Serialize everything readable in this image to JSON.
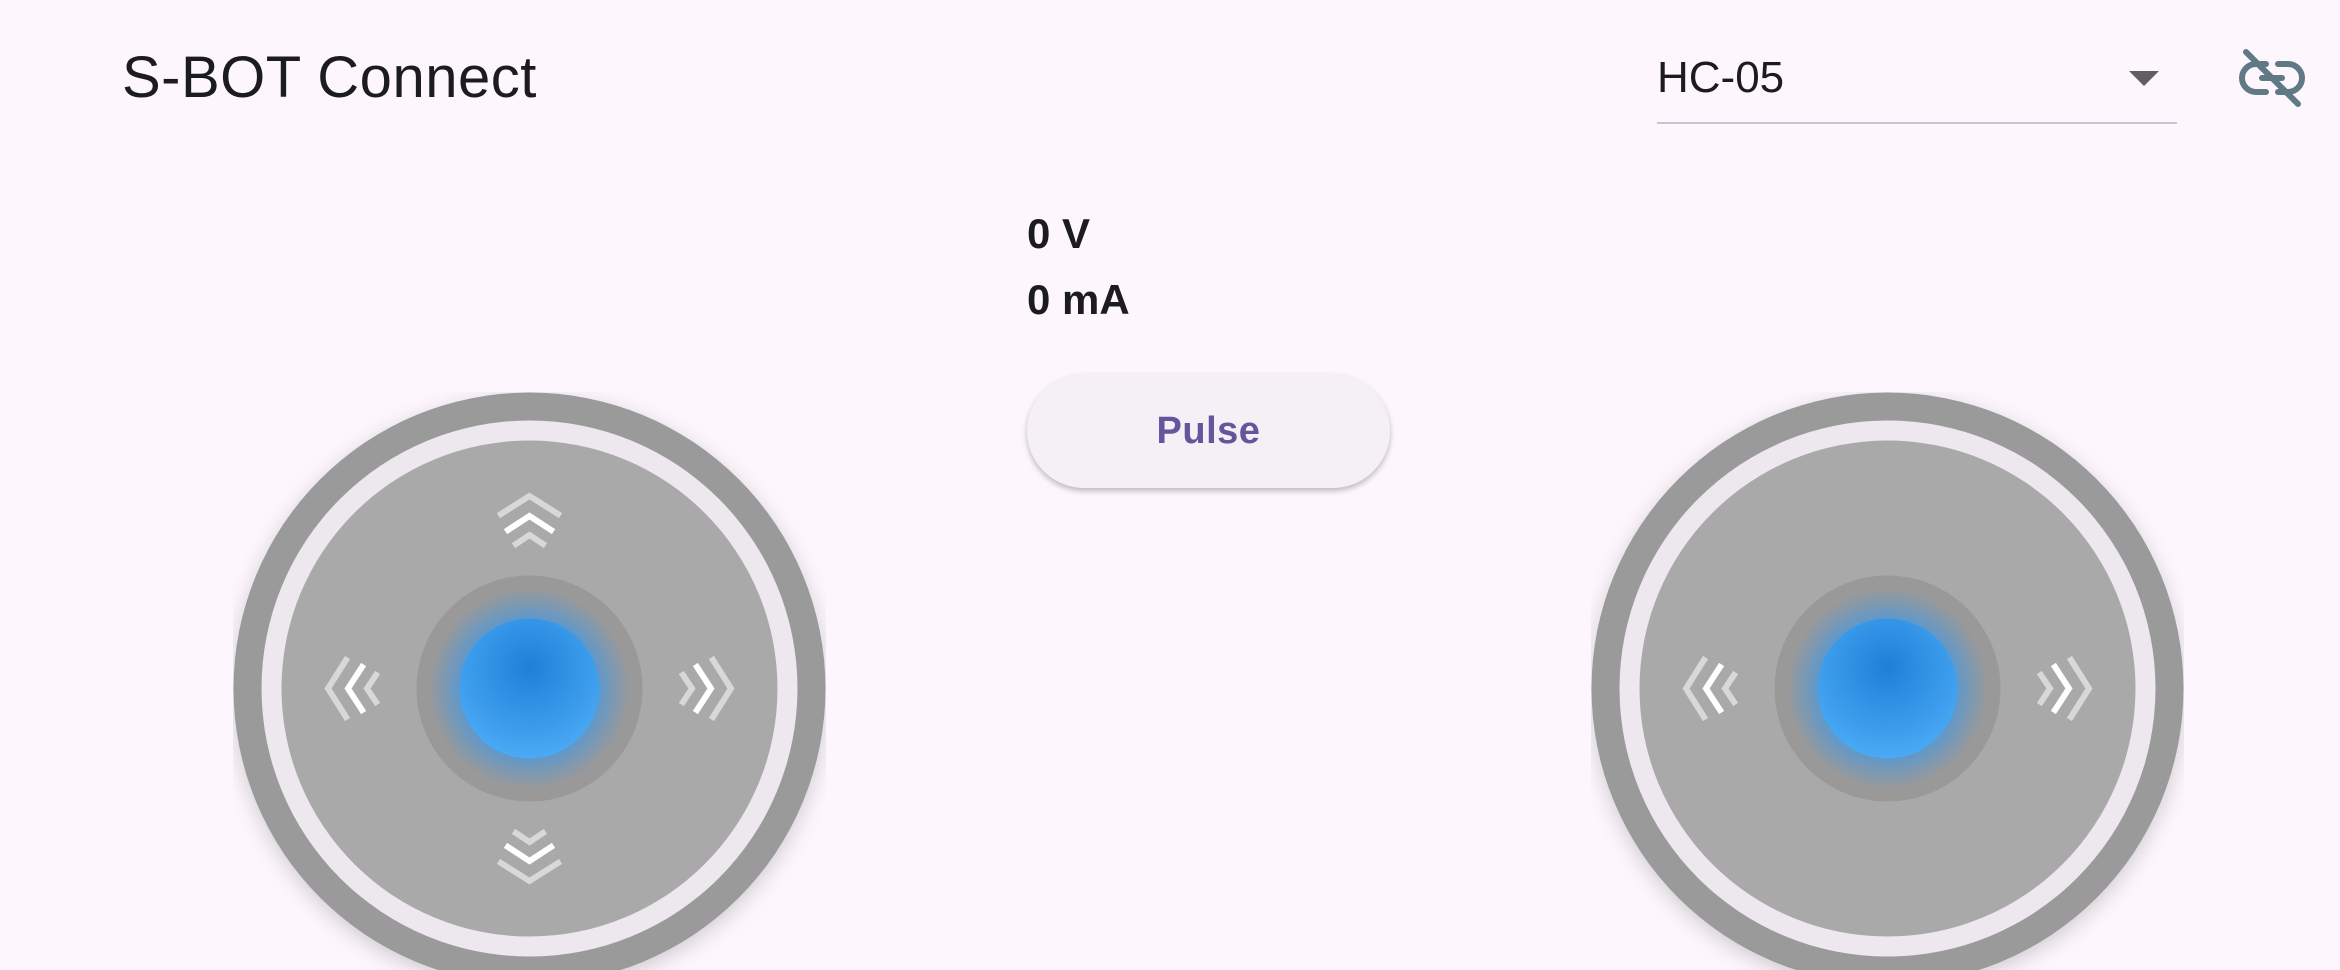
{
  "app": {
    "title": "S-BOT Connect"
  },
  "device_selector": {
    "selected": "HC-05"
  },
  "connection": {
    "icon": "link-off-icon",
    "icon_color": "#5f7a84"
  },
  "readouts": {
    "voltage": "0 V",
    "current": "0 mA"
  },
  "pulse_button": {
    "label": "Pulse",
    "label_color": "#63569b"
  },
  "joysticks": {
    "left": {
      "directions": [
        "up",
        "down",
        "left",
        "right"
      ]
    },
    "right": {
      "directions": [
        "left",
        "right"
      ]
    },
    "knob_color": "#1f8fe8",
    "ring_color": "#9a9a9a"
  }
}
